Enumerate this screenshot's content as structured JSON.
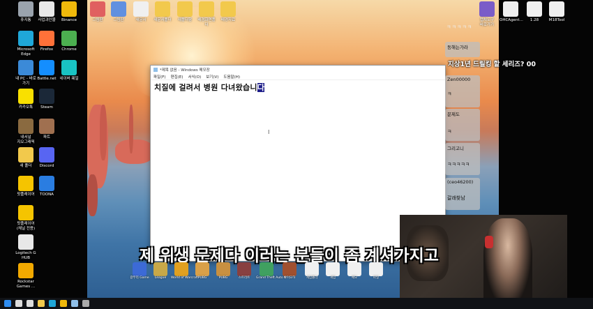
{
  "desktop_icons_left": [
    {
      "label": "휴지통",
      "icon": "recycle-bin-icon",
      "color": "#9aa3ad"
    },
    {
      "label": "사업과인물",
      "icon": "document-icon",
      "color": "#e8e8e8"
    },
    {
      "label": "Binance",
      "icon": "binance-icon",
      "color": "#f0b90b"
    },
    {
      "label": "Microsoft\nEdge",
      "icon": "edge-icon",
      "color": "#1fa7d8"
    },
    {
      "label": "Firefox",
      "icon": "firefox-icon",
      "color": "#ff7139"
    },
    {
      "label": "Chrome",
      "icon": "chrome-icon",
      "color": "#4caf50"
    },
    {
      "label": "내 PC - 바로\n가기",
      "icon": "pc-icon",
      "color": "#3b8ad8"
    },
    {
      "label": "Battle.net",
      "icon": "battlenet-icon",
      "color": "#148eff"
    },
    {
      "label": "네이버 웨일",
      "icon": "whale-icon",
      "color": "#19c3c3"
    },
    {
      "label": "카카오톡",
      "icon": "kakaotalk-icon",
      "color": "#f9e000"
    },
    {
      "label": "Steam",
      "icon": "steam-icon",
      "color": "#1b2838"
    },
    {
      "label": "내서널\n지오그래픽",
      "icon": "folder-icon",
      "color": "#8a6a40"
    },
    {
      "label": "파트",
      "icon": "image-icon",
      "color": "#a07050"
    },
    {
      "label": "새 폴더",
      "icon": "folder-icon",
      "color": "#f2c94c"
    },
    {
      "label": "Discord",
      "icon": "discord-icon",
      "color": "#5865f2"
    },
    {
      "label": "팟플레이어",
      "icon": "potplayer-icon",
      "color": "#f5c400"
    },
    {
      "label": "TOONA",
      "icon": "toona-icon",
      "color": "#2a7de1"
    },
    {
      "label": "팟플레이어\n(채널 전용)",
      "icon": "potplayer-icon",
      "color": "#f5c400"
    },
    {
      "label": "Logitech G\nHUB",
      "icon": "logitech-icon",
      "color": "#e8e8e8"
    },
    {
      "label": "Rockstar\nGames ...",
      "icon": "rockstar-icon",
      "color": "#f2a900"
    }
  ],
  "desktop_icons_top": [
    {
      "label": "그림판",
      "icon": "paint-icon",
      "color": "#e06060"
    },
    {
      "label": "그림판",
      "icon": "paint-icon",
      "color": "#6090e0"
    },
    {
      "label": "새문서",
      "icon": "document-icon",
      "color": "#f0f0f0"
    },
    {
      "label": "새문서폴더",
      "icon": "folder-icon",
      "color": "#f2c94c"
    },
    {
      "label": "새폴더함",
      "icon": "folder-icon",
      "color": "#f2c94c"
    },
    {
      "label": "배경화면폴더",
      "icon": "folder-icon",
      "color": "#f2c94c"
    },
    {
      "label": "배경자료",
      "icon": "folder-icon",
      "color": "#f2c94c"
    }
  ],
  "desktop_icons_right": [
    {
      "label": "캡쳐도구\n바로가기",
      "icon": "capture-icon",
      "color": "#7a5cc8"
    },
    {
      "label": "OHCAgent...",
      "icon": "document-icon",
      "color": "#f0f0f0"
    },
    {
      "label": "1.28",
      "icon": "document-icon",
      "color": "#f0f0f0"
    },
    {
      "label": "M18Tool",
      "icon": "document-icon",
      "color": "#f0f0f0"
    }
  ],
  "notepad": {
    "title": "*제목 없음 - Windows 메모장",
    "menu": [
      "파일(F)",
      "편집(E)",
      "서식(O)",
      "보기(V)",
      "도움말(H)"
    ],
    "text_main": "치질에 걸려서 병원 다녀왔습니",
    "text_selected": "다"
  },
  "chat": {
    "top_line": "ㅋㅋㅋㅋㅋ",
    "big_line": "지상1년 드릴킹 할 세리즈? 00",
    "items": [
      {
        "name": "동해는가라",
        "msg": ""
      },
      {
        "name": "Zen00000",
        "msg": "ㅋ"
      },
      {
        "name": "문제도",
        "msg": "ㅋ"
      },
      {
        "name": "그리고니",
        "msg": "ㅋㅋㅋㅋㅋ"
      },
      {
        "name": "(ceo46200)",
        "msg": "갈래찾남"
      }
    ]
  },
  "subtitle": "제 위생 문제다 이러는 분들이 좀 계셔가지고",
  "dock_icons": [
    {
      "label": "갈무리 Game",
      "icon": "game-icon",
      "color": "#3c6ad6"
    },
    {
      "label": "League",
      "icon": "league-icon",
      "color": "#c8a848"
    },
    {
      "label": "World of\nWarcraft",
      "icon": "wow-icon",
      "color": "#e0a020"
    },
    {
      "label": "PUBG",
      "icon": "pubg-icon",
      "color": "#d9a048"
    },
    {
      "label": "PUBG",
      "icon": "pubg-icon",
      "color": "#c89040"
    },
    {
      "label": "스트리트",
      "icon": "game-icon",
      "color": "#884040"
    },
    {
      "label": "Grand Theft\nAuto V",
      "icon": "gta-icon",
      "color": "#40a060"
    },
    {
      "label": "바이오하",
      "icon": "game-icon",
      "color": "#a05030"
    },
    {
      "label": "게임폴더",
      "icon": "document-icon",
      "color": "#f0f0f0"
    },
    {
      "label": "게임",
      "icon": "document-icon",
      "color": "#f0f0f0"
    },
    {
      "label": "메모",
      "icon": "document-icon",
      "color": "#f0f0f0"
    },
    {
      "label": "파일",
      "icon": "document-icon",
      "color": "#f0f0f0"
    }
  ],
  "taskbar": [
    {
      "icon": "start-icon",
      "color": "#2f8df0"
    },
    {
      "icon": "search-icon",
      "color": "#dddddd"
    },
    {
      "icon": "task-view-icon",
      "color": "#dddddd"
    },
    {
      "icon": "file-explorer-icon",
      "color": "#f2c94c"
    },
    {
      "icon": "edge-icon",
      "color": "#1fa7d8"
    },
    {
      "icon": "binance-icon",
      "color": "#f0b90b"
    },
    {
      "icon": "notepad-icon",
      "color": "#8fbfe8"
    },
    {
      "icon": "app-icon",
      "color": "#aaaaaa"
    }
  ]
}
